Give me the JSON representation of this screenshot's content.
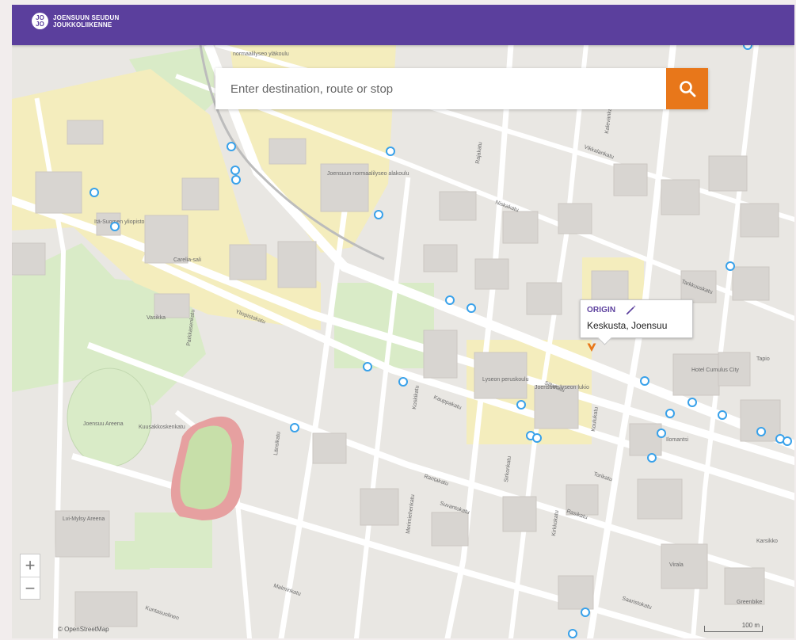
{
  "header": {
    "logo_mark": "JO JO",
    "logo_line1": "JOENSUUN SEUDUN",
    "logo_line2": "JOUKKOLIIKENNE"
  },
  "search": {
    "placeholder": "Enter destination, route or stop",
    "button_icon": "search-icon"
  },
  "origin_popup": {
    "title": "ORIGIN",
    "edit_icon": "pencil-icon",
    "place": "Keskusta, Joensuu"
  },
  "map": {
    "attribution": "© OpenStreetMap",
    "scale_label": "100 m",
    "zoom_in_label": "+",
    "zoom_out_label": "−",
    "place_labels": [
      "normaalilyseo yläkoulu",
      "Itä-Suomen yliopisto",
      "Carelia-sali",
      "Joensuun normaalilyseo alakoulu",
      "Joensuu Areena",
      "Kuusakkoskenkatu",
      "Lyseon peruskoulu",
      "Joensuun lyseon lukio",
      "Hotel Cumulus City",
      "Lvi-Mylsy Areena",
      "Tapio",
      "Karsikko",
      "Vasikka",
      "Virala",
      "Ilomantsi",
      "Greenbike"
    ],
    "street_labels": [
      "Yliopistokatu",
      "Siltakatu",
      "Kauppakatu",
      "Rantakatu",
      "Torikatu",
      "Koulukatu",
      "Kirkkokatu",
      "Länsikatu",
      "Merimiehenkatu",
      "Niskakatu",
      "Vikkalankatu",
      "Rajakatu",
      "Malminkatu",
      "Kuntasuolinen",
      "Saaristokatu",
      "Kalevankatu",
      "Rasikatu",
      "Tarkkuuskatu",
      "Suvantokatu",
      "Sirkonkatu",
      "Parkkasenkatu",
      "Koskikatu"
    ],
    "colors": {
      "map_background": "#e9e7e3",
      "building": "#d8d5d1",
      "campus": "#f4edbd",
      "park": "#d9ebc7",
      "track": "#e6a0a0",
      "transit_stop": "#38a1ea",
      "origin": "#e8771a",
      "brand": "#5b3f9d"
    }
  }
}
